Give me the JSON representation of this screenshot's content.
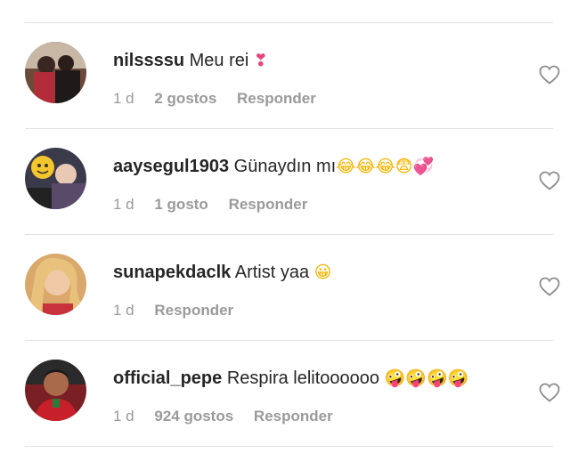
{
  "comments": [
    {
      "username": "nilssssu",
      "text": "Meu rei",
      "emoji": "❣",
      "time": "1 d",
      "likes": "2 gostos",
      "reply": "Responder"
    },
    {
      "username": "aaysegul1903",
      "text": "Günaydın mı",
      "emoji": "😂😂😂😨",
      "emoji2": "💞",
      "time": "1 d",
      "likes": "1 gosto",
      "reply": "Responder"
    },
    {
      "username": "sunapekdaclk",
      "text": "Artist yaa",
      "emoji": "😀",
      "time": "1 d",
      "likes": "",
      "reply": "Responder"
    },
    {
      "username": "official_pepe",
      "text": "Respira lelitoooooo",
      "emoji": "🤪🤪🤪🤪",
      "time": "1 d",
      "likes": "924 gostos",
      "reply": "Responder"
    }
  ],
  "icons": {
    "like": "heart-outline-icon"
  },
  "colors": {
    "text": "#262626",
    "meta": "#9a9a9a",
    "divider": "#e2e2e2"
  }
}
